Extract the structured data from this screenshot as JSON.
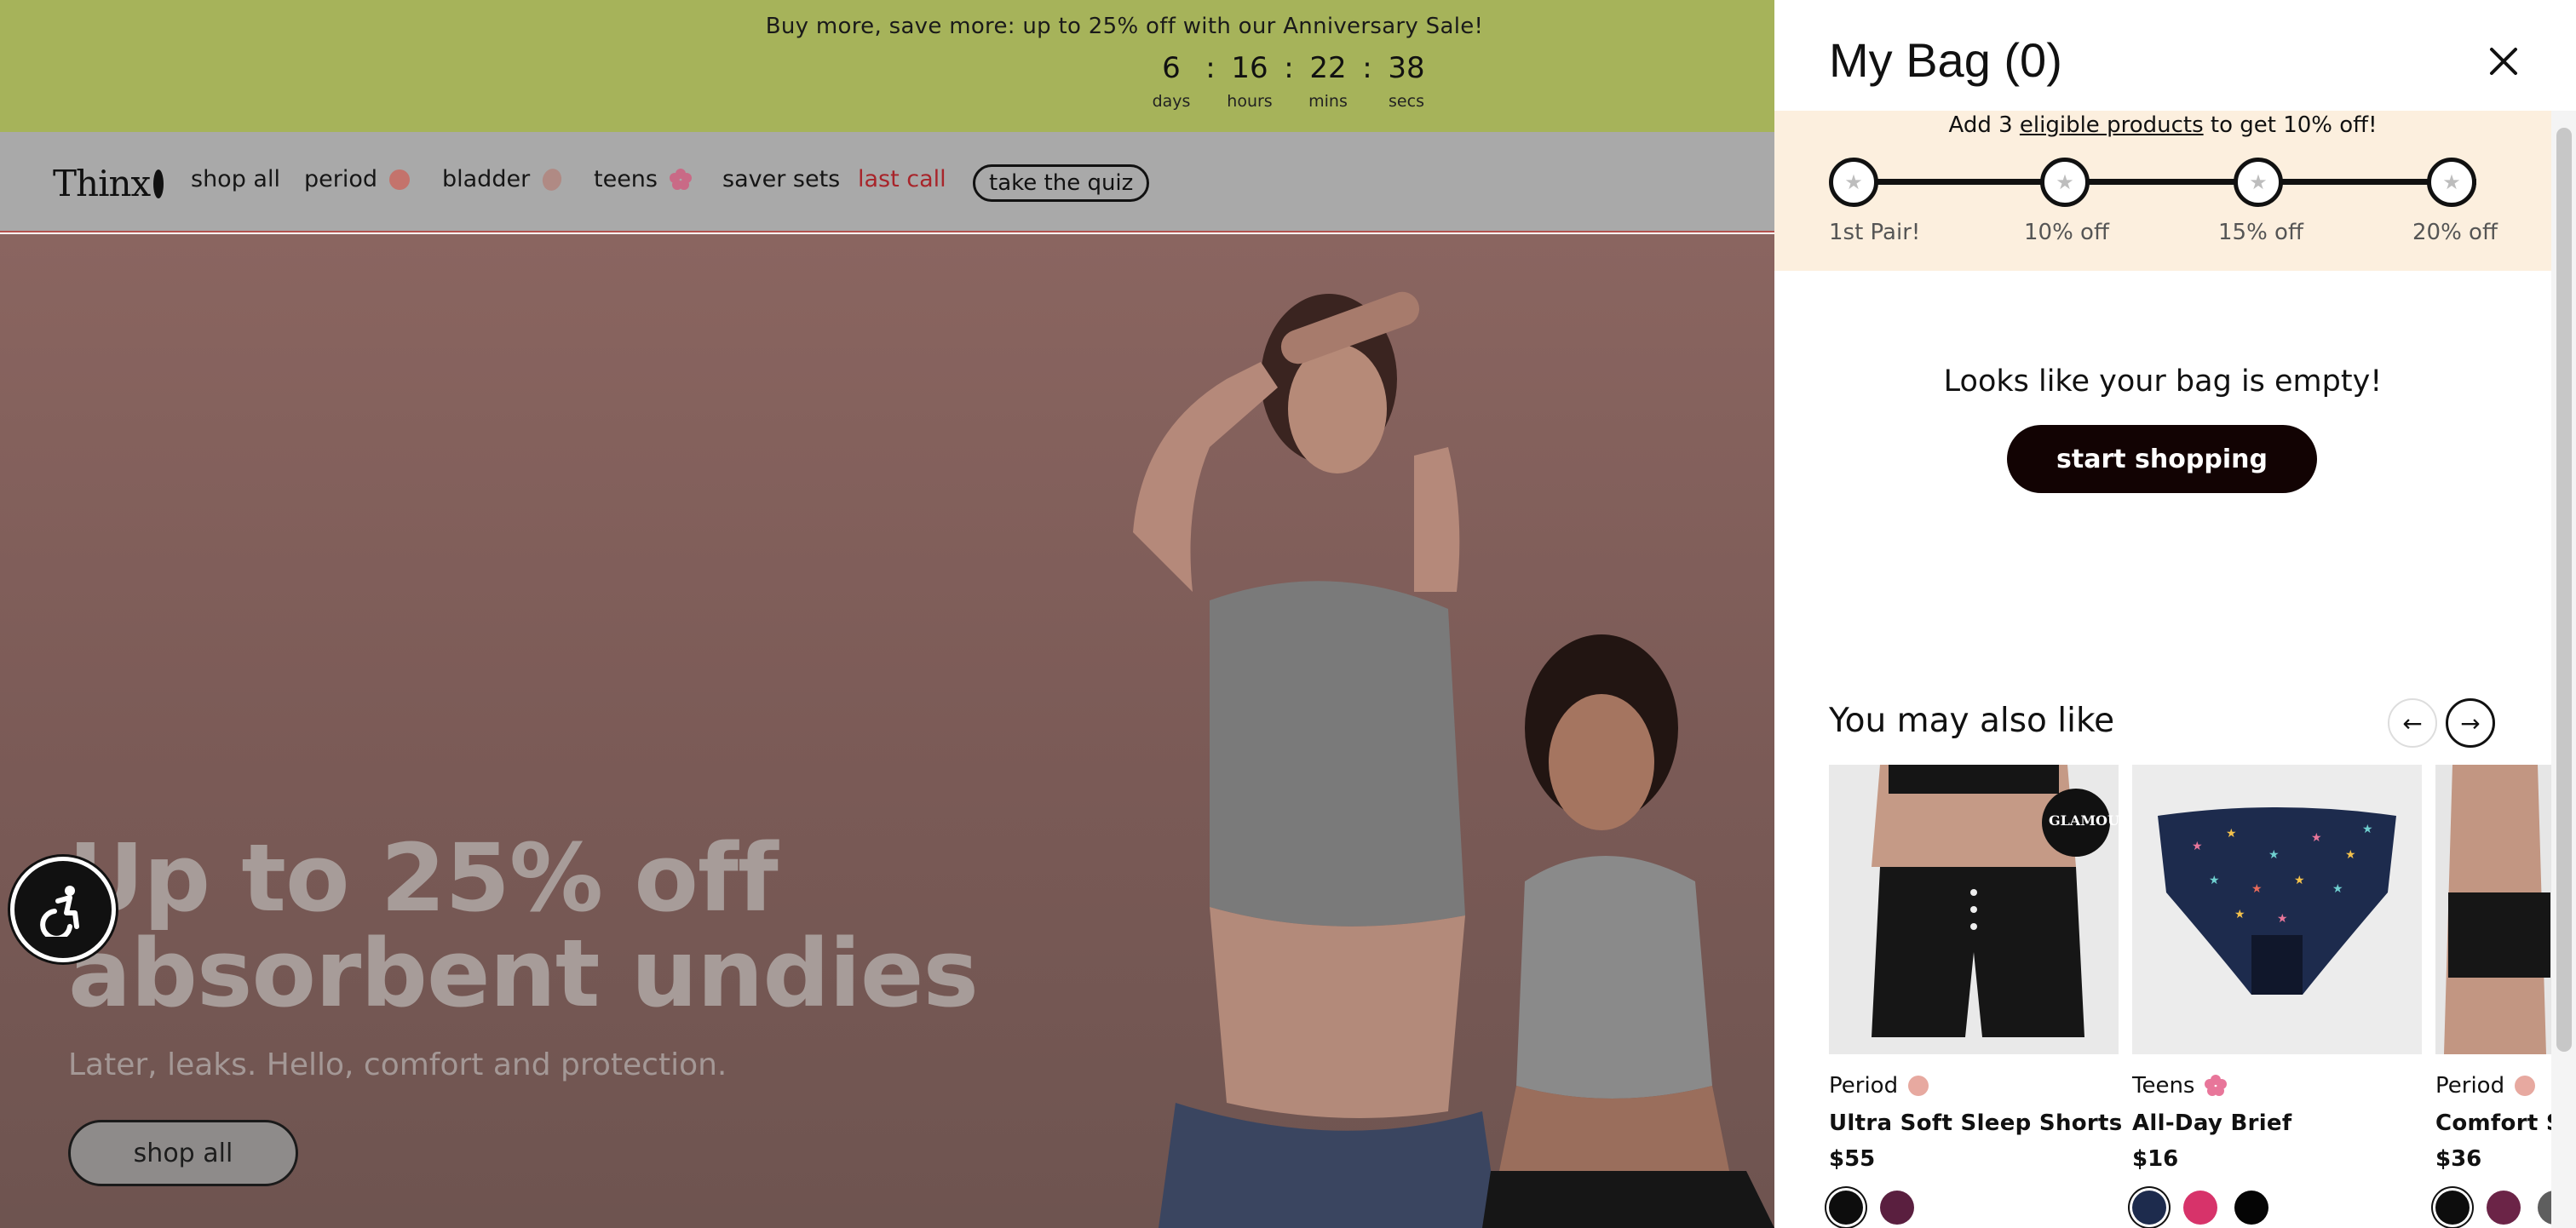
{
  "promo": {
    "message": "Buy more, save more: up to 25% off with our  Anniversary Sale!",
    "countdown": [
      {
        "value": "6",
        "label": "days"
      },
      {
        "value": "16",
        "label": "hours"
      },
      {
        "value": "22",
        "label": "mins"
      },
      {
        "value": "38",
        "label": "secs"
      }
    ],
    "separator": ":"
  },
  "nav": {
    "logo": "Thinx",
    "items": [
      {
        "label": "shop all"
      },
      {
        "label": "period",
        "dot_color": "#c4736c"
      },
      {
        "label": "bladder",
        "dot_color": "#b08a84"
      },
      {
        "label": "teens",
        "dot_color": "#c96a86"
      },
      {
        "label": "saver sets"
      },
      {
        "label": "last call"
      }
    ],
    "quiz_label": "take the quiz"
  },
  "hero": {
    "title_line1": "Up to 25% off",
    "title_line2": "absorbent undies",
    "subtitle": "Later, leaks. Hello, comfort and protection.",
    "cta": "shop all"
  },
  "accessibility": {
    "icon": "accessibility-icon"
  },
  "bag": {
    "title": "My Bag (0)",
    "progress_prefix": "Add 3 ",
    "progress_link": "eligible products",
    "progress_suffix": " to get 10% off!",
    "milestones": [
      {
        "label": "1st Pair!"
      },
      {
        "label": "10% off"
      },
      {
        "label": "15% off"
      },
      {
        "label": "20% off"
      }
    ],
    "empty_message": "Looks like your bag is empty!",
    "start_button": "start shopping"
  },
  "recommendations": {
    "title": "You may also like",
    "prev_icon": "arrow-left-icon",
    "next_icon": "arrow-right-icon",
    "products": [
      {
        "category": "Period",
        "category_color": "#e7a9a0",
        "name": "Ultra Soft Sleep Shorts",
        "price": "$55",
        "badge": "GLAMOUR",
        "swatches": [
          "#0d0d0d",
          "#5a1f3f"
        ]
      },
      {
        "category": "Teens",
        "category_color": "#e8769a",
        "name": "All-Day Brief",
        "price": "$16",
        "swatches": [
          "#1d2b4d",
          "#d7336a",
          "#050505"
        ]
      },
      {
        "category": "Period",
        "category_color": "#e7a9a0",
        "name": "Comfort St",
        "price": "$36",
        "swatches": [
          "#0d0d0d",
          "#6b2447",
          "#5e5e5e"
        ]
      }
    ]
  },
  "colors": {
    "promo_bg": "#a6b35a",
    "progress_bg": "#fcefde",
    "primary_button": "#120303",
    "nav_last_call": "#a8242a"
  }
}
